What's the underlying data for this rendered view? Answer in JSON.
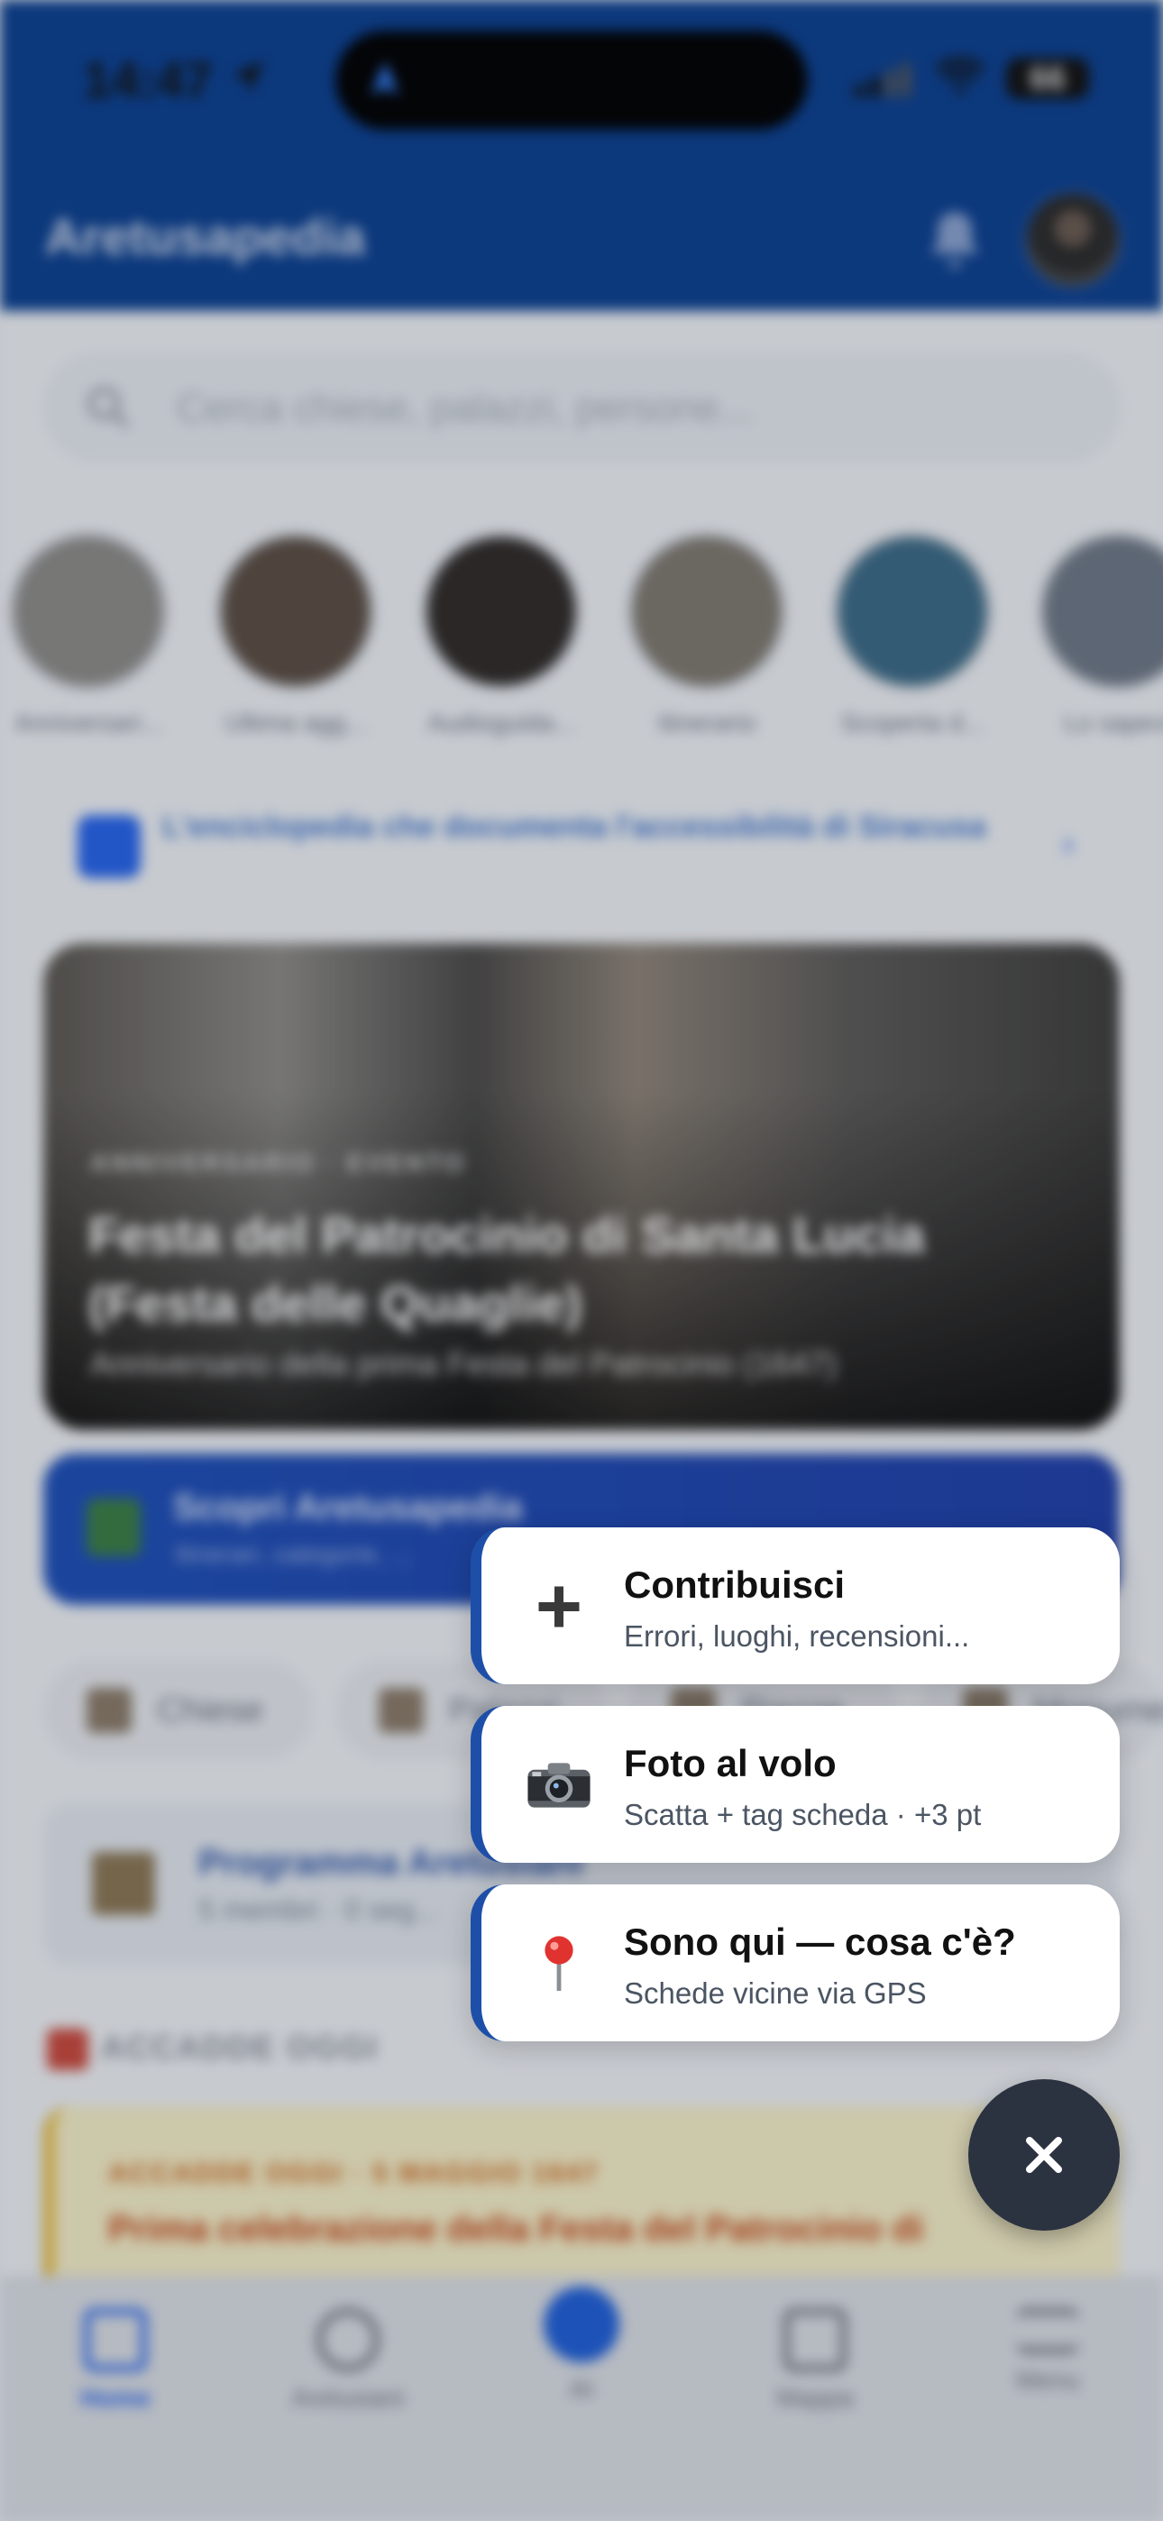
{
  "status_bar": {
    "time": "14:47",
    "battery": "66"
  },
  "app": {
    "title": "Aretusapedia"
  },
  "search": {
    "placeholder": "Cerca chiese, palazzi, persone..."
  },
  "stories": [
    {
      "label": "Anniversari..."
    },
    {
      "label": "Ultima agg..."
    },
    {
      "label": "Audioguida..."
    },
    {
      "label": "Itinerario"
    },
    {
      "label": "Scoperta d..."
    },
    {
      "label": "Lo sapevi"
    }
  ],
  "accessibility_banner": {
    "text": "L'enciclopedia che documenta l'accessibilità di Siracusa"
  },
  "hero": {
    "kicker": "ANNIVERSARIO · EVENTO",
    "title": "Festa del Patrocinio di Santa Lucia (Festa delle Quaglie)",
    "subtitle": "Anniversario della prima Festa del Patrocinio (1647)"
  },
  "discover": {
    "title": "Scopri Aretusapedia",
    "subtitle": "Itinerari, categorie, ..."
  },
  "chips": [
    "Chiese",
    "Palazzi",
    "Piazze",
    "Monumenti"
  ],
  "program": {
    "title": "Programma Aretusiani",
    "subtitle": "5 membri · 0 seg..."
  },
  "today_section": {
    "heading": "ACCADDE OGGI"
  },
  "today_card": {
    "kicker": "ACCADDE OGGI · 5 MAGGIO 1647",
    "title": "Prima celebrazione della Festa del Patrocinio di"
  },
  "tabbar": [
    {
      "label": "Home"
    },
    {
      "label": "Aretusiani"
    },
    {
      "label": "AI"
    },
    {
      "label": "Mappa"
    },
    {
      "label": "Menu"
    }
  ],
  "quick_menu": [
    {
      "title": "Contribuisci",
      "subtitle": "Errori, luoghi, recensioni...",
      "icon": "plus-icon"
    },
    {
      "title": "Foto al volo",
      "subtitle": "Scatta + tag scheda · +3 pt",
      "icon": "camera-icon"
    },
    {
      "title": "Sono qui — cosa c'è?",
      "subtitle": "Schede vicine via GPS",
      "icon": "pin-icon"
    }
  ],
  "colors": {
    "primary": "#0a3f8f",
    "accent": "#1e4fa8",
    "fab": "#2b3240"
  }
}
